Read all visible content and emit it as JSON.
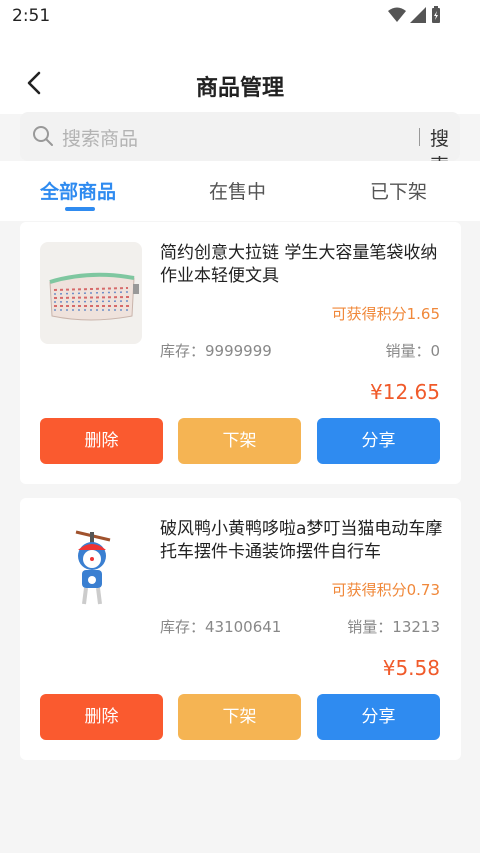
{
  "status_bar": {
    "time": "2:51"
  },
  "header": {
    "title": "商品管理"
  },
  "search": {
    "placeholder": "搜索商品",
    "button_label": "搜索"
  },
  "tabs": [
    {
      "label": "全部商品",
      "active": true
    },
    {
      "label": "在售中",
      "active": false
    },
    {
      "label": "已下架",
      "active": false
    }
  ],
  "products": [
    {
      "title": "简约创意大拉链 学生大容量笔袋收纳作业本轻便文具",
      "points": "可获得积分1.65",
      "stock": "库存：9999999",
      "sales": "销量：0",
      "price": "¥12.65"
    },
    {
      "title": "破风鸭小黄鸭哆啦a梦叮当猫电动车摩托车摆件卡通装饰摆件自行车",
      "points": "可获得积分0.73",
      "stock": "库存：43100641",
      "sales": "销量：13213",
      "price": "¥5.58"
    }
  ],
  "actions": {
    "delete": "删除",
    "off_shelf": "下架",
    "share": "分享"
  },
  "colors": {
    "accent": "#2f8bf0",
    "delete": "#fa5a2f",
    "off_shelf": "#f5b453",
    "price": "#f05a2a",
    "points": "#f0883a"
  }
}
